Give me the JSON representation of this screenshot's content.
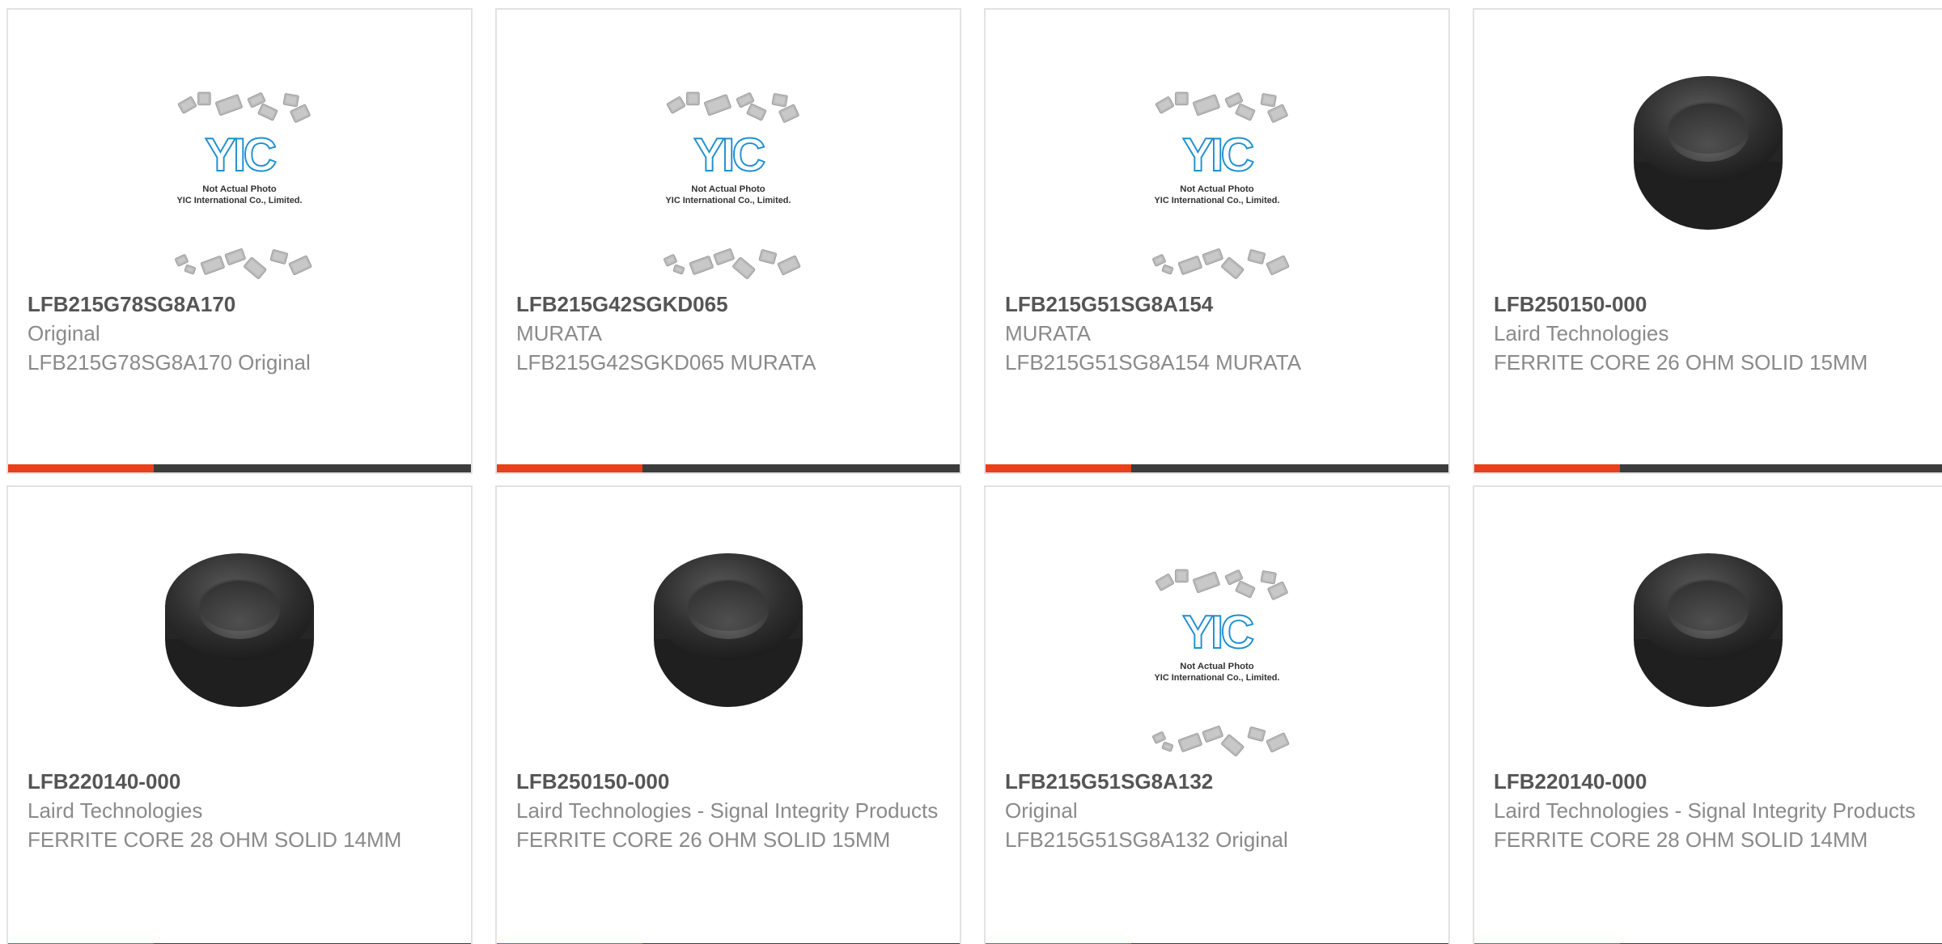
{
  "products": [
    {
      "part": "LFB215G78SG8A170",
      "manufacturer": "Original",
      "description": "LFB215G78SG8A170 Original",
      "image": "placeholder"
    },
    {
      "part": "LFB215G42SGKD065",
      "manufacturer": "MURATA",
      "description": "LFB215G42SGKD065 MURATA",
      "image": "placeholder"
    },
    {
      "part": "LFB215G51SG8A154",
      "manufacturer": "MURATA",
      "description": "LFB215G51SG8A154 MURATA",
      "image": "placeholder"
    },
    {
      "part": "LFB250150-000",
      "manufacturer": "Laird Technologies",
      "description": "FERRITE CORE 26 OHM SOLID 15MM",
      "image": "ferrite-core"
    },
    {
      "part": "LFB220140-000",
      "manufacturer": "Laird Technologies",
      "description": "FERRITE CORE 28 OHM SOLID 14MM",
      "image": "ferrite-core"
    },
    {
      "part": "LFB250150-000",
      "manufacturer": "Laird Technologies - Signal Integrity Products",
      "description": "FERRITE CORE 26 OHM SOLID 15MM",
      "image": "ferrite-core"
    },
    {
      "part": "LFB215G51SG8A132",
      "manufacturer": "Original",
      "description": "LFB215G51SG8A132 Original",
      "image": "placeholder"
    },
    {
      "part": "LFB220140-000",
      "manufacturer": "Laird Technologies - Signal Integrity Products",
      "description": "FERRITE CORE 28 OHM SOLID 14MM",
      "image": "ferrite-core"
    }
  ],
  "placeholder": {
    "brand": "YIC",
    "line1": "Not Actual Photo",
    "line2": "YIC International Co., Limited."
  },
  "colors": {
    "accent": "#e8401c",
    "bar": "#3c3c3c",
    "brand": "#1f8fd0"
  }
}
